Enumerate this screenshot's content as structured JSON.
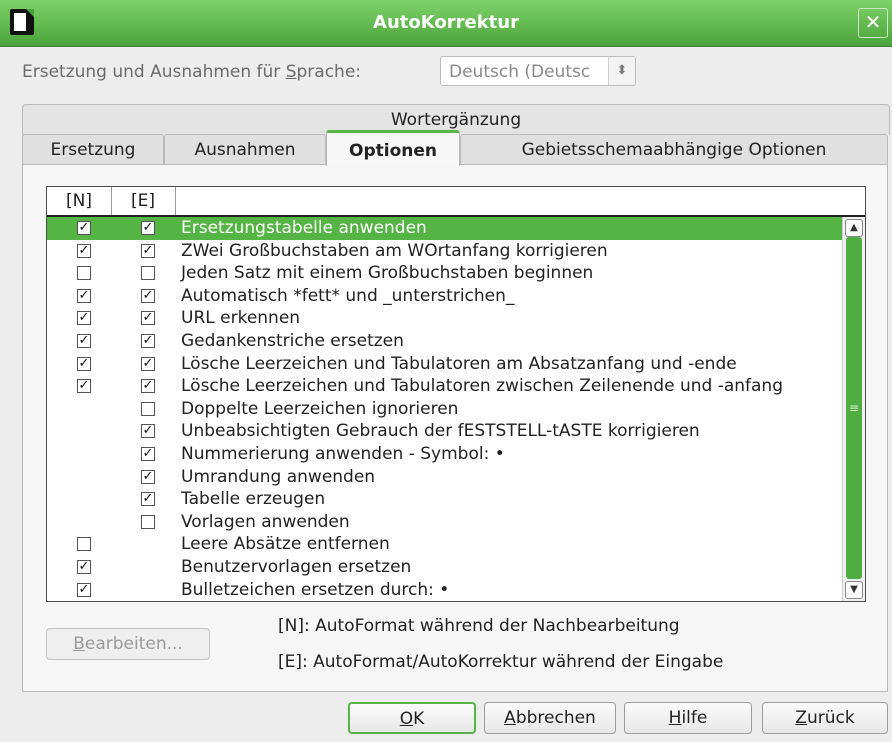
{
  "window": {
    "title": "AutoKorrektur",
    "close_glyph": "✕"
  },
  "language": {
    "label_pre": "Ersetzung und Ausnahmen für ",
    "label_key": "S",
    "label_post": "prache:",
    "value": "Deutsch (Deutsc",
    "spin_glyph": "⬍"
  },
  "tabs": {
    "top": "Wortergänzung",
    "row": [
      "Ersetzung",
      "Ausnahmen",
      "Optionen",
      "Gebietsschemaabhängige Optionen"
    ],
    "active": "Optionen"
  },
  "table": {
    "headers": [
      "[N]",
      "[E]",
      ""
    ],
    "rows": [
      {
        "n": true,
        "e": true,
        "label": "Ersetzungstabelle anwenden",
        "selected": true
      },
      {
        "n": true,
        "e": true,
        "label": "ZWei Großbuchstaben am WOrtanfang korrigieren"
      },
      {
        "n": false,
        "e": false,
        "label": "Jeden Satz mit einem Großbuchstaben beginnen"
      },
      {
        "n": true,
        "e": true,
        "label": "Automatisch *fett* und _unterstrichen_"
      },
      {
        "n": true,
        "e": true,
        "label": "URL erkennen"
      },
      {
        "n": true,
        "e": true,
        "label": "Gedankenstriche ersetzen"
      },
      {
        "n": true,
        "e": true,
        "label": "Lösche Leerzeichen und Tabulatoren am Absatzanfang und -ende"
      },
      {
        "n": true,
        "e": true,
        "label": "Lösche Leerzeichen und Tabulatoren zwischen Zeilenende und -anfang"
      },
      {
        "n": null,
        "e": false,
        "label": "Doppelte Leerzeichen ignorieren"
      },
      {
        "n": null,
        "e": true,
        "label": "Unbeabsichtigten Gebrauch der fESTSTELL-tASTE korrigieren"
      },
      {
        "n": null,
        "e": true,
        "label": "Nummerierung anwenden - Symbol: •"
      },
      {
        "n": null,
        "e": true,
        "label": "Umrandung anwenden"
      },
      {
        "n": null,
        "e": true,
        "label": "Tabelle erzeugen"
      },
      {
        "n": null,
        "e": false,
        "label": "Vorlagen anwenden"
      },
      {
        "n": false,
        "e": null,
        "label": "Leere Absätze entfernen"
      },
      {
        "n": true,
        "e": null,
        "label": "Benutzervorlagen ersetzen"
      },
      {
        "n": true,
        "e": null,
        "label": "Bulletzeichen ersetzen durch: •"
      }
    ],
    "check_glyph": "✓",
    "scroll_up_glyph": "▲",
    "scroll_down_glyph": "▼",
    "scroll_grip": "≡"
  },
  "edit_button": {
    "key": "B",
    "rest": "earbeiten..."
  },
  "legend": {
    "n": "[N]: AutoFormat während der Nachbearbeitung",
    "e": "[E]: AutoFormat/AutoKorrektur während der Eingabe"
  },
  "buttons": {
    "ok": {
      "key": "O",
      "rest": "K"
    },
    "cancel": {
      "key": "A",
      "rest": "bbrechen"
    },
    "help": {
      "key": "H",
      "rest": "ilfe"
    },
    "reset": {
      "key": "Z",
      "rest": "urück"
    }
  }
}
